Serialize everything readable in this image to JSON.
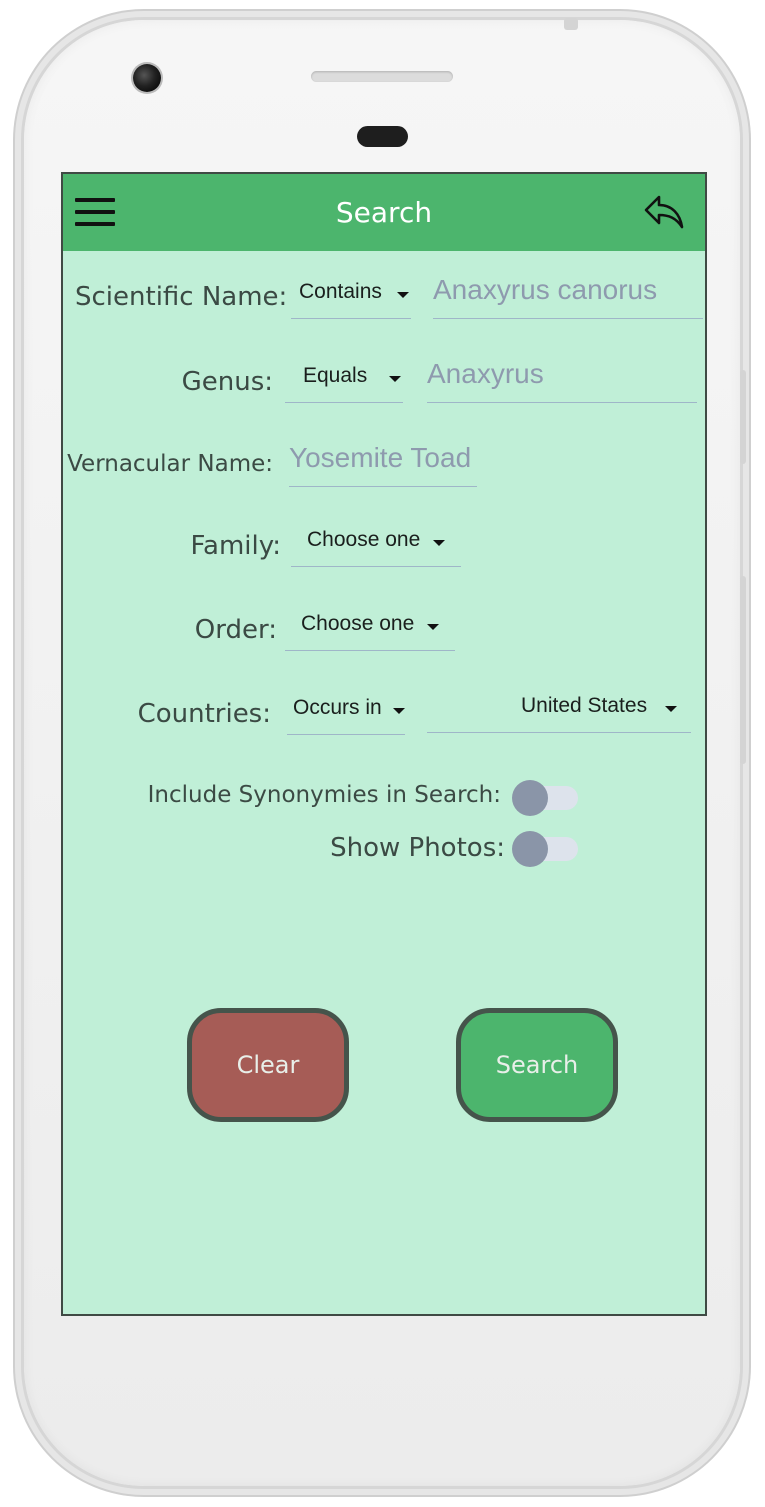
{
  "header": {
    "title": "Search"
  },
  "form": {
    "scientific_name": {
      "label": "Scientific Name:",
      "operator": "Contains",
      "placeholder": "Anaxyrus canorus"
    },
    "genus": {
      "label": "Genus:",
      "operator": "Equals",
      "placeholder": "Anaxyrus"
    },
    "vernacular_name": {
      "label": "Vernacular Name:",
      "placeholder": "Yosemite Toad"
    },
    "family": {
      "label": "Family:",
      "selected": "Choose one"
    },
    "order": {
      "label": "Order:",
      "selected": "Choose one"
    },
    "countries": {
      "label": "Countries:",
      "operator": "Occurs in",
      "selected": "United States"
    },
    "include_synonymies": {
      "label": "Include Synonymies in Search:",
      "on": false
    },
    "show_photos": {
      "label": "Show Photos:",
      "on": false
    }
  },
  "actions": {
    "clear_label": "Clear",
    "search_label": "Search"
  },
  "colors": {
    "header_bg": "#4cb56d",
    "screen_bg": "#c0efd7",
    "clear_bg": "#a65c56",
    "search_bg": "#4cb56d",
    "placeholder": "#8e9aae",
    "toggle_knob": "#8a95a8"
  },
  "icons": {
    "menu": "hamburger-menu-icon",
    "back": "reply-arrow-icon"
  }
}
